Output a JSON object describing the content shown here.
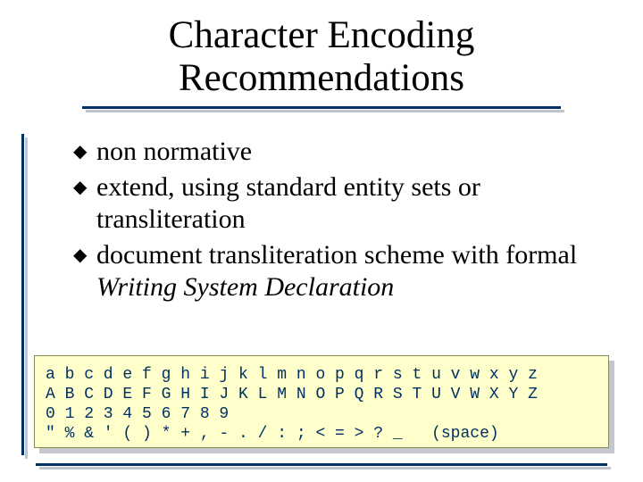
{
  "title": {
    "line1": "Character Encoding",
    "line2": "Recommendations"
  },
  "bullets": {
    "items": [
      {
        "text_a": "non normative",
        "text_b": "",
        "italic_b": false
      },
      {
        "text_a": "extend, using standard entity sets or transliteration",
        "text_b": "",
        "italic_b": false
      },
      {
        "text_a": "document transliteration scheme with formal ",
        "text_b": "Writing System Declaration",
        "italic_b": true
      }
    ],
    "glyph": "◆"
  },
  "code": {
    "line1": "a b c d e f g h i j k l m n o p q r s t u v w x y z",
    "line2": "A B C D E F G H I J K L M N O P Q R S T U V W X Y Z",
    "line3": "0 1 2 3 4 5 6 7 8 9",
    "line4": "\" % & ' ( ) * + , - . / : ; < = > ? _   (space)"
  }
}
